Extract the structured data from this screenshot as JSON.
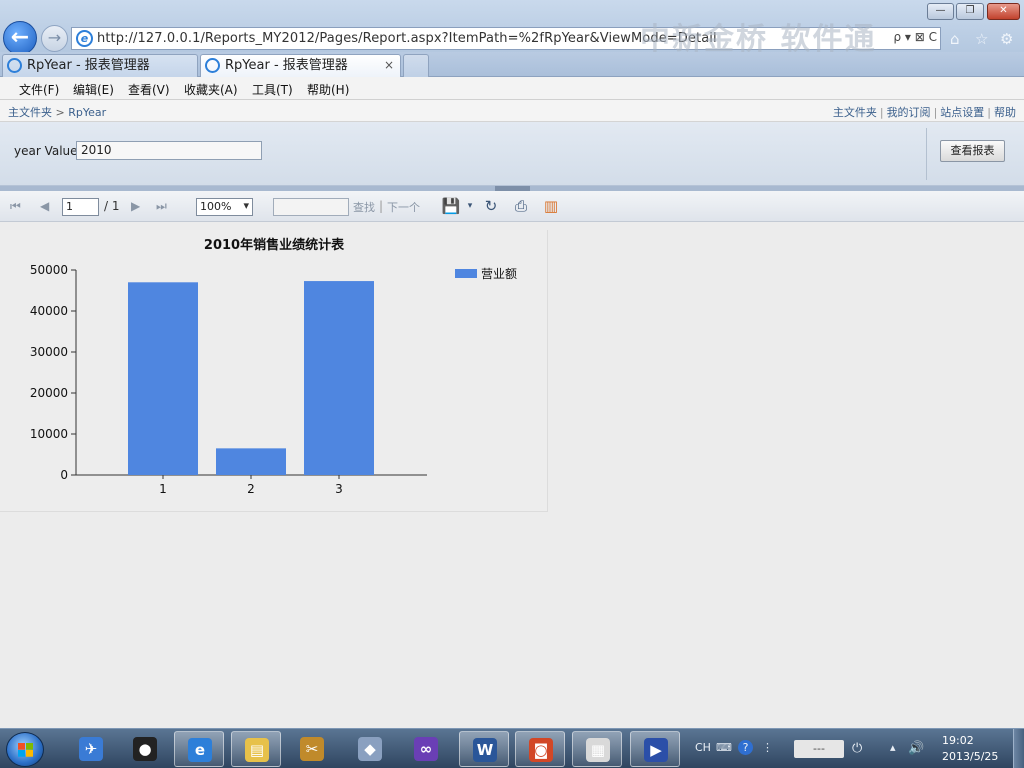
{
  "browser": {
    "url": "http://127.0.0.1/Reports_MY2012/Pages/Report.aspx?ItemPath=%2fRpYear&ViewMode=Detail",
    "watermark": "中新金桥 软件通",
    "tabs": [
      {
        "label": "RpYear - 报表管理器"
      },
      {
        "label": "RpYear - 报表管理器"
      }
    ],
    "tab_close": "×",
    "window_controls": {
      "minimize": "—",
      "maximize": "❐",
      "close": "✕"
    },
    "addr_tools": "ρ ▾ ⊠ C"
  },
  "menu": [
    "文件(F)",
    "编辑(E)",
    "查看(V)",
    "收藏夹(A)",
    "工具(T)",
    "帮助(H)"
  ],
  "report_manager": {
    "breadcrumb": {
      "root": "主文件夹",
      "separator": ">",
      "current": "RpYear"
    },
    "links": [
      "主文件夹",
      "我的订阅",
      "站点设置",
      "帮助"
    ]
  },
  "parameters": {
    "label": "year Value",
    "value": "2010",
    "view_button": "查看报表"
  },
  "toolbar": {
    "page_value": "1",
    "page_total": "/ 1",
    "zoom": "100%",
    "find_label": "查找",
    "find_separator": "|",
    "next_label": "下一个"
  },
  "chart_data": {
    "type": "bar",
    "title": "2010年销售业绩统计表",
    "categories": [
      "1",
      "2",
      "3"
    ],
    "series": [
      {
        "name": "营业额",
        "values": [
          47000,
          6500,
          47300
        ],
        "color": "#4f86e0"
      }
    ],
    "ylim": [
      0,
      50000
    ],
    "yticks": [
      0,
      10000,
      20000,
      30000,
      40000,
      50000
    ],
    "grid": false,
    "legend": "top-right"
  },
  "taskbar": {
    "apps": [
      {
        "icon": "bird-icon",
        "glyph": "✈",
        "color": "#3a7bd5"
      },
      {
        "icon": "qq-penguin-icon",
        "glyph": "●",
        "color": "#222"
      },
      {
        "icon": "ie-icon",
        "glyph": "e",
        "color": "#2d7fd9"
      },
      {
        "icon": "folder-icon",
        "glyph": "▤",
        "color": "#e7c14a"
      },
      {
        "icon": "tools-icon",
        "glyph": "✂",
        "color": "#c08a2b"
      },
      {
        "icon": "app-icon",
        "glyph": "◆",
        "color": "#8aa0c0"
      },
      {
        "icon": "infinity-icon",
        "glyph": "∞",
        "color": "#6a3fb5"
      },
      {
        "icon": "word-icon",
        "glyph": "W",
        "color": "#2a5699"
      },
      {
        "icon": "presentation-icon",
        "glyph": "◙",
        "color": "#d24726"
      },
      {
        "icon": "document-settings-icon",
        "glyph": "▦",
        "color": "#d9d9d9"
      },
      {
        "icon": "network-flag-icon",
        "glyph": "▶",
        "color": "#2b4fa8"
      }
    ],
    "tray": {
      "lang": "CH",
      "box": "---",
      "time": "19:02",
      "date": "2013/5/25"
    }
  }
}
